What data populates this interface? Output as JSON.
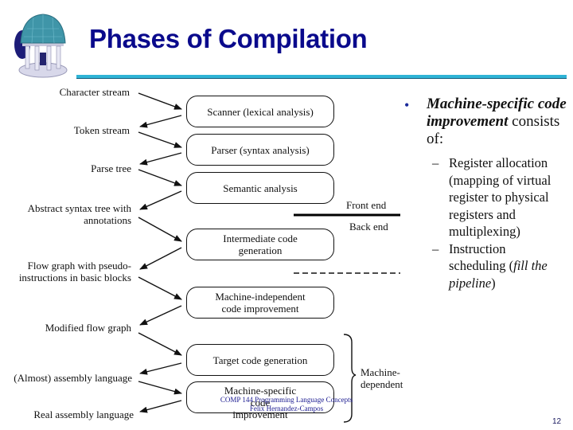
{
  "slide": {
    "title": "Phases of Compilation",
    "page_number": "12",
    "accent_color": "#0a0a8c",
    "rule_color": "#2fb4d6",
    "footer": {
      "line1": "COMP 144 Programming Language Concepts",
      "line2": "Felix Hernandez-Campos"
    }
  },
  "diagram": {
    "phases": [
      {
        "label": "Scanner (lexical analysis)"
      },
      {
        "label": "Parser (syntax analysis)"
      },
      {
        "label": "Semantic analysis"
      },
      {
        "label": "Intermediate code generation"
      },
      {
        "label": "Machine-independent code improvement"
      },
      {
        "label": "Target code generation"
      },
      {
        "label": "Machine-specific code improvement"
      }
    ],
    "artifacts": [
      {
        "label": "Character stream"
      },
      {
        "label": "Token stream"
      },
      {
        "label": "Parse tree"
      },
      {
        "label": "Abstract syntax tree with annotations"
      },
      {
        "label": "Flow graph with pseudo-instructions in basic blocks"
      },
      {
        "label": "Modified flow graph"
      },
      {
        "label": "(Almost) assembly language"
      },
      {
        "label": "Real assembly language"
      }
    ],
    "front_end_label": "Front end",
    "back_end_label": "Back end",
    "machine_dependent_label": "Machine-dependent"
  },
  "bullets": {
    "main_emph": "Machine-specific code improvement",
    "main_rest": "consists of:",
    "subitems": [
      {
        "text": "Register allocation (mapping of virtual register to physical registers and multiplexing)"
      },
      {
        "text_bold": "Instruction scheduling (",
        "text_italic": "fill the pipeline",
        "text_end": ")"
      }
    ]
  }
}
